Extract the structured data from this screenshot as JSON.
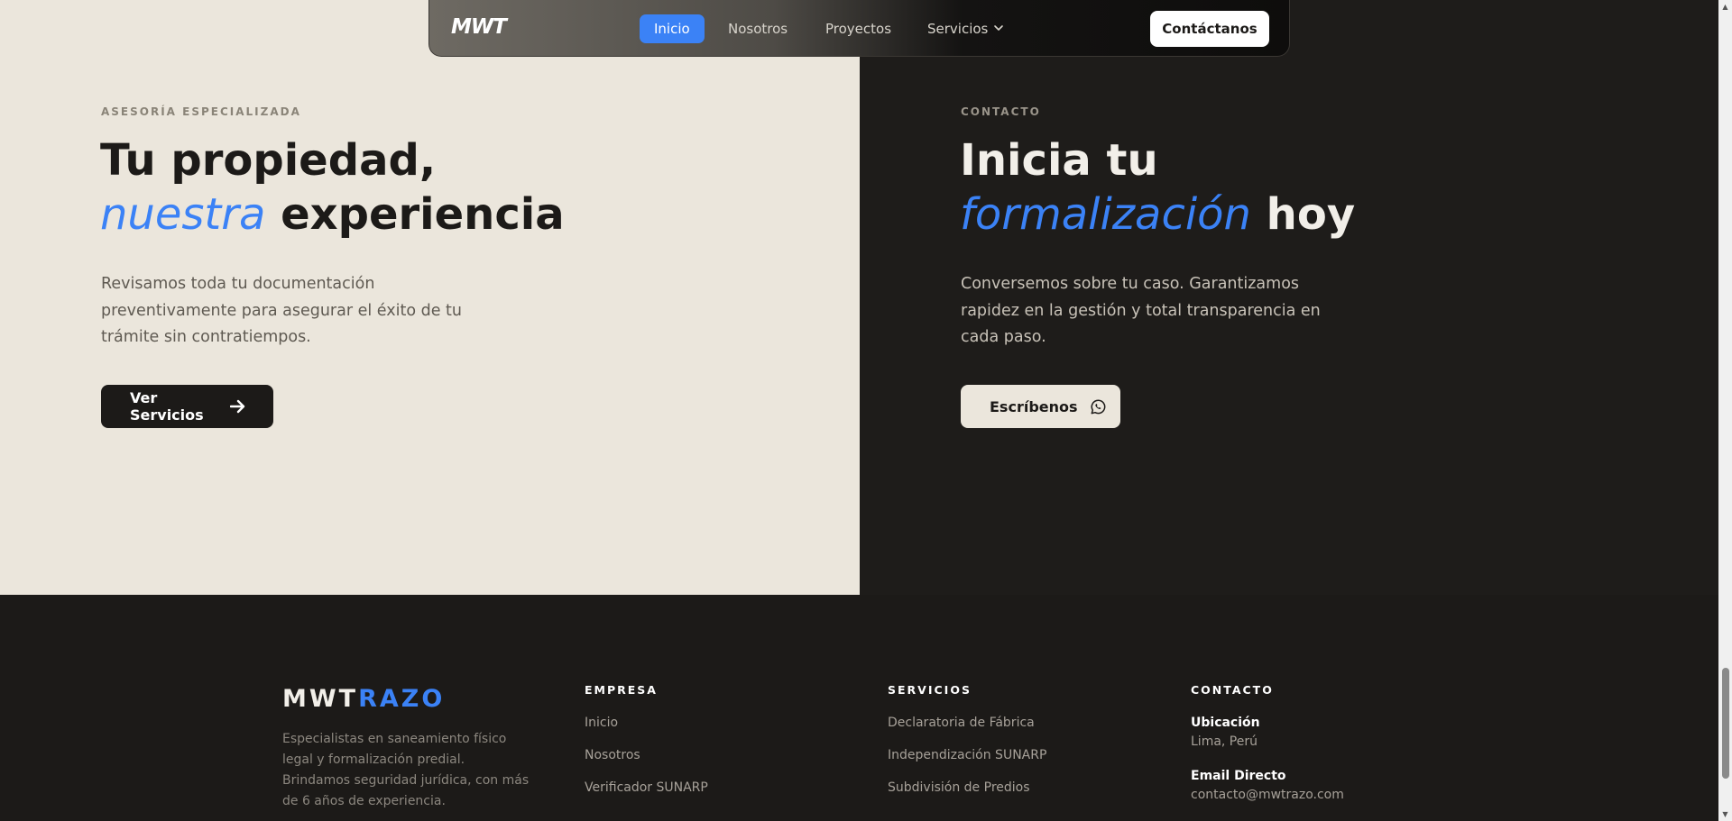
{
  "nav": {
    "logo": "MWT",
    "links": [
      "Inicio",
      "Nosotros",
      "Proyectos",
      "Servicios"
    ],
    "active": "Inicio",
    "cta": "Contáctanos"
  },
  "left": {
    "eyebrow": "ASESORÍA ESPECIALIZADA",
    "headline_line1": "Tu propiedad,",
    "headline_accent": "nuestra",
    "headline_rest": " experiencia",
    "description": "Revisamos toda tu documentación preventivamente para asegurar el éxito de tu trámite sin contratiempos.",
    "button": "Ver Servicios"
  },
  "right": {
    "eyebrow": "CONTACTO",
    "headline_line1": "Inicia tu",
    "headline_accent": "formalización",
    "headline_rest": " hoy",
    "description": "Conversemos sobre tu caso. Garantizamos rapidez en la gestión y total transparencia en cada paso.",
    "button": "Escríbenos"
  },
  "footer": {
    "logo_a": "MWT",
    "logo_b": "RAZO",
    "description": "Especialistas en saneamiento físico legal y formalización predial. Brindamos seguridad jurídica, con más de 6 años de experiencia.",
    "empresa": {
      "title": "EMPRESA",
      "links": [
        "Inicio",
        "Nosotros",
        "Verificador SUNARP"
      ]
    },
    "servicios": {
      "title": "SERVICIOS",
      "links": [
        "Declaratoria de Fábrica",
        "Independización SUNARP",
        "Subdivisión de Predios"
      ]
    },
    "contacto": {
      "title": "CONTACTO",
      "location_label": "Ubicación",
      "location_value": "Lima, Perú",
      "email_label": "Email Directo",
      "email_value": "contacto@mwtrazo.com"
    }
  },
  "colors": {
    "accent": "#3b82f6",
    "dark": "#1c1a18",
    "cream": "#ebe6dc"
  }
}
